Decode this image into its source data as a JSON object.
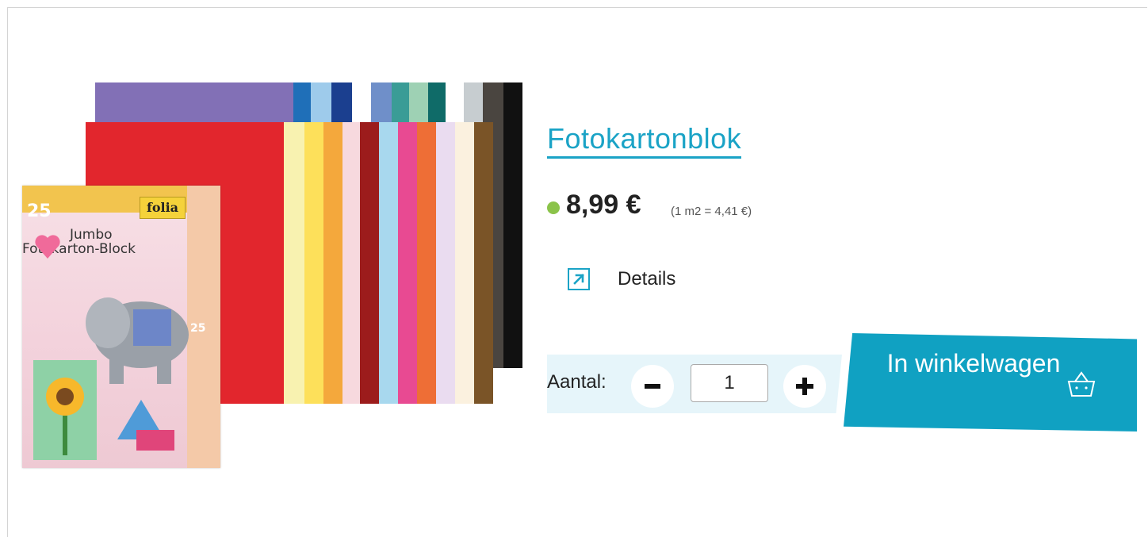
{
  "product": {
    "title": "Fotokartonblok",
    "price": "8,99 €",
    "unit_price": "(1 m2 = 4,41 €)",
    "stock_color": "#8bc34a",
    "details_label": "Details",
    "image": {
      "pack_brand": "folia",
      "pack_number": "25",
      "pack_line1": "Jumbo",
      "pack_line2": "Fotokarton-Block",
      "side_number": "25"
    }
  },
  "cart": {
    "quantity_label": "Aantal:",
    "quantity_value": "1",
    "button_label": "In winkelwagen",
    "accent_color": "#10a1c2"
  },
  "icons": {
    "details": "arrow-up-right-icon",
    "minus": "minus-icon",
    "plus": "plus-icon",
    "cart": "basket-icon"
  }
}
